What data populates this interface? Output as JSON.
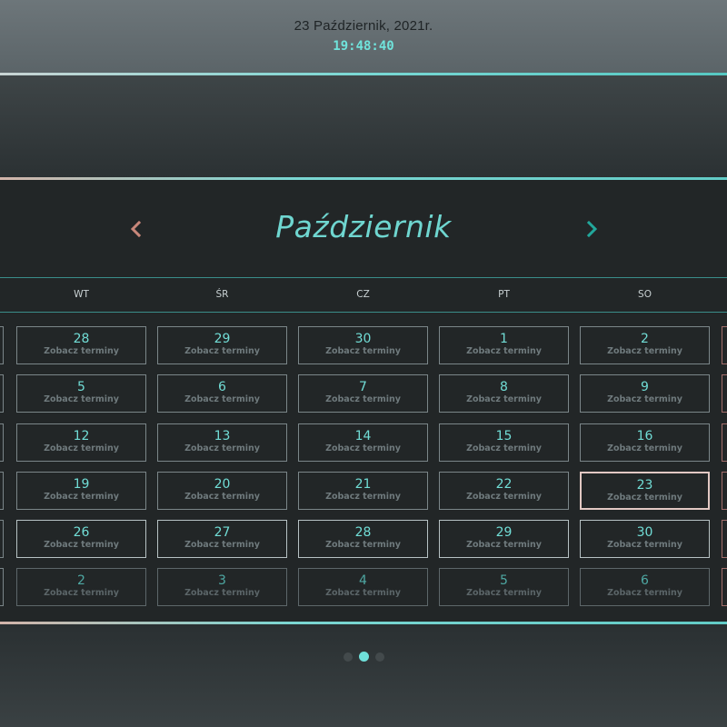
{
  "header": {
    "date": "23 Październik, 2021r.",
    "time": "19:48:40"
  },
  "calendar": {
    "month": "Październik",
    "weekdays": [
      "WT",
      "ŚR",
      "CZ",
      "PT",
      "SO"
    ],
    "cell_label": "Zobacz terminy",
    "weeks": [
      [
        "28",
        "29",
        "30",
        "1",
        "2"
      ],
      [
        "5",
        "6",
        "7",
        "8",
        "9"
      ],
      [
        "12",
        "13",
        "14",
        "15",
        "16"
      ],
      [
        "19",
        "20",
        "21",
        "22",
        "23"
      ],
      [
        "26",
        "27",
        "28",
        "29",
        "30"
      ],
      [
        "2",
        "3",
        "4",
        "5",
        "6"
      ]
    ],
    "today": "23"
  },
  "pager": {
    "pages": 3,
    "active_index": 1
  },
  "colors": {
    "accent": "#6fd6d0",
    "today_border": "#e2c8c3",
    "background": "#222627"
  },
  "icons": {
    "prev": "chevron-left-icon",
    "next": "chevron-right-icon"
  }
}
